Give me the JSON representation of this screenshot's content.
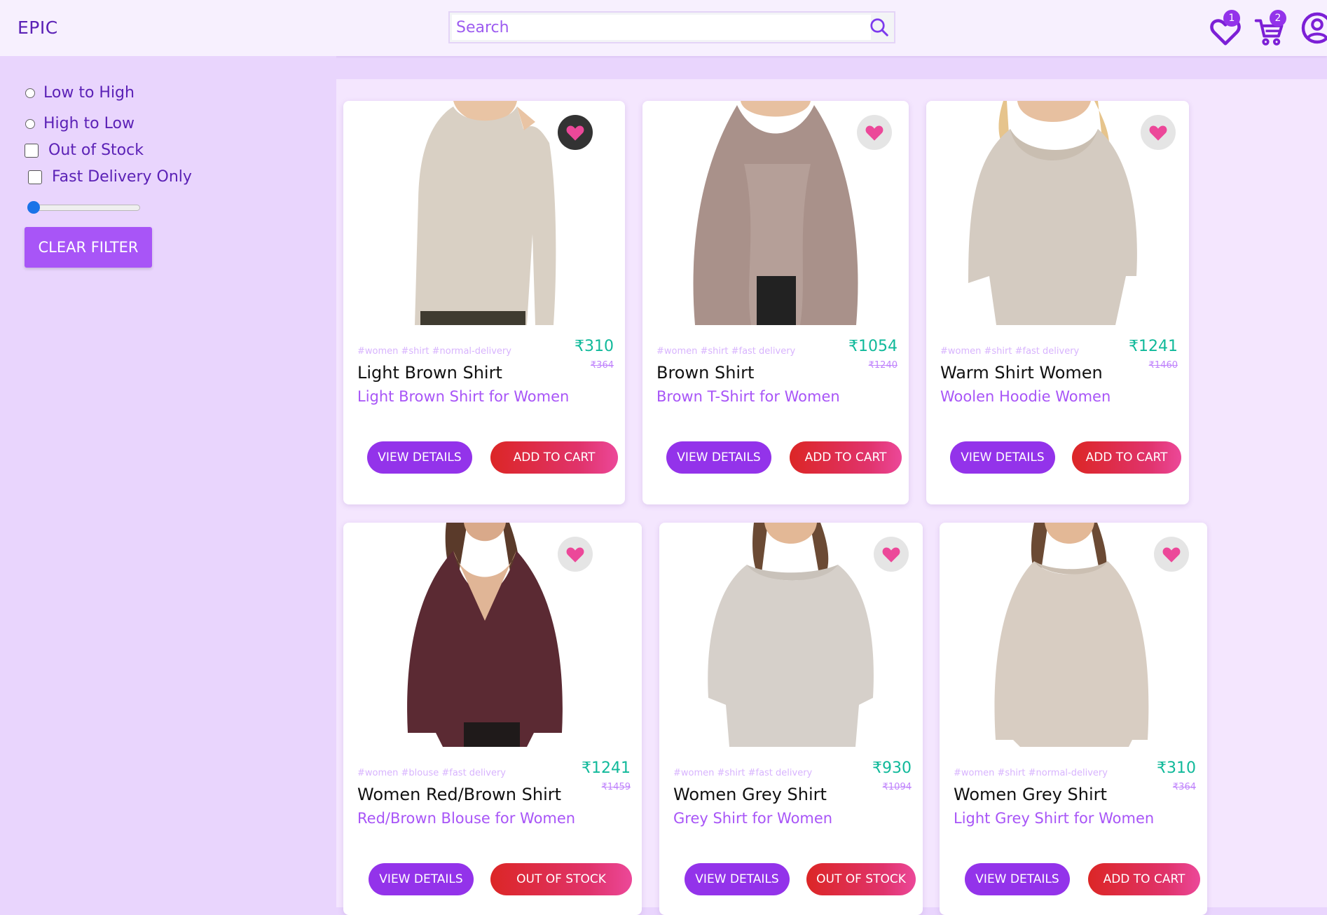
{
  "header": {
    "brand": "EPIC",
    "search_placeholder": "Search",
    "wishlist_count": "1",
    "cart_count": "2"
  },
  "sidebar": {
    "sort_low_high": "Low to High",
    "sort_high_low": "High to Low",
    "out_of_stock": "Out of Stock",
    "fast_delivery": "Fast Delivery Only",
    "price_slider_value": 0,
    "clear_filter": "CLEAR FILTER"
  },
  "colors": {
    "accent": "#9333ea",
    "price": "#10b99a",
    "heart": "#ec4899",
    "background": "#e9d5fd"
  },
  "products": [
    {
      "tags": "#women #shirt #normal-delivery",
      "price": "₹310",
      "mrp": "₹364",
      "name": "Light Brown Shirt",
      "desc": "Light Brown Shirt for Women",
      "view": "VIEW DETAILS",
      "cart": "ADD TO CART",
      "wishlisted": true
    },
    {
      "tags": "#women #shirt #fast delivery",
      "price": "₹1054",
      "mrp": "₹1240",
      "name": "Brown Shirt",
      "desc": "Brown T-Shirt for Women",
      "view": "VIEW DETAILS",
      "cart": "ADD TO CART",
      "wishlisted": false
    },
    {
      "tags": "#women #shirt #fast delivery",
      "price": "₹1241",
      "mrp": "₹1460",
      "name": "Warm Shirt Women",
      "desc": "Woolen Hoodie Women",
      "view": "VIEW DETAILS",
      "cart": "ADD TO CART",
      "wishlisted": false
    },
    {
      "tags": "#women #blouse #fast delivery",
      "price": "₹1241",
      "mrp": "₹1459",
      "name": "Women Red/Brown Shirt",
      "desc": "Red/Brown Blouse for Women",
      "view": "VIEW DETAILS",
      "cart": "OUT OF STOCK",
      "wishlisted": false
    },
    {
      "tags": "#women #shirt #fast delivery",
      "price": "₹930",
      "mrp": "₹1094",
      "name": "Women Grey Shirt",
      "desc": "Grey Shirt for Women",
      "view": "VIEW DETAILS",
      "cart": "OUT OF STOCK",
      "wishlisted": false
    },
    {
      "tags": "#women #shirt #normal-delivery",
      "price": "₹310",
      "mrp": "₹364",
      "name": "Women Grey Shirt",
      "desc": "Light Grey Shirt for Women",
      "view": "VIEW DETAILS",
      "cart": "ADD TO CART",
      "wishlisted": false
    }
  ]
}
